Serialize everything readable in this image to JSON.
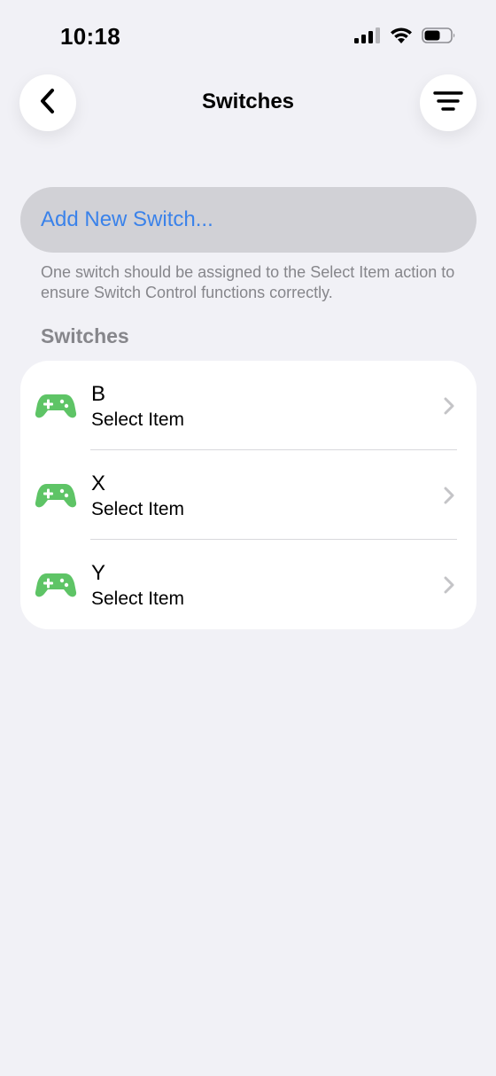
{
  "status_bar": {
    "time": "10:18",
    "icons": [
      "cellular-signal-icon",
      "wifi-icon",
      "battery-icon"
    ]
  },
  "nav": {
    "title": "Switches",
    "back_icon": "chevron-left-icon",
    "menu_icon": "filter-lines-icon"
  },
  "add_switch": {
    "label": "Add New Switch..."
  },
  "footnote": "One switch should be assigned to the Select Item action to ensure Switch Control functions correctly.",
  "section": {
    "header": "Switches"
  },
  "switches": [
    {
      "name": "B",
      "action": "Select Item",
      "icon": "gamepad-icon"
    },
    {
      "name": "X",
      "action": "Select Item",
      "icon": "gamepad-icon"
    },
    {
      "name": "Y",
      "action": "Select Item",
      "icon": "gamepad-icon"
    }
  ],
  "colors": {
    "background": "#f1f1f6",
    "accent": "#3a82ea",
    "gamepad": "#5ec466",
    "secondary_text": "#86868b"
  }
}
